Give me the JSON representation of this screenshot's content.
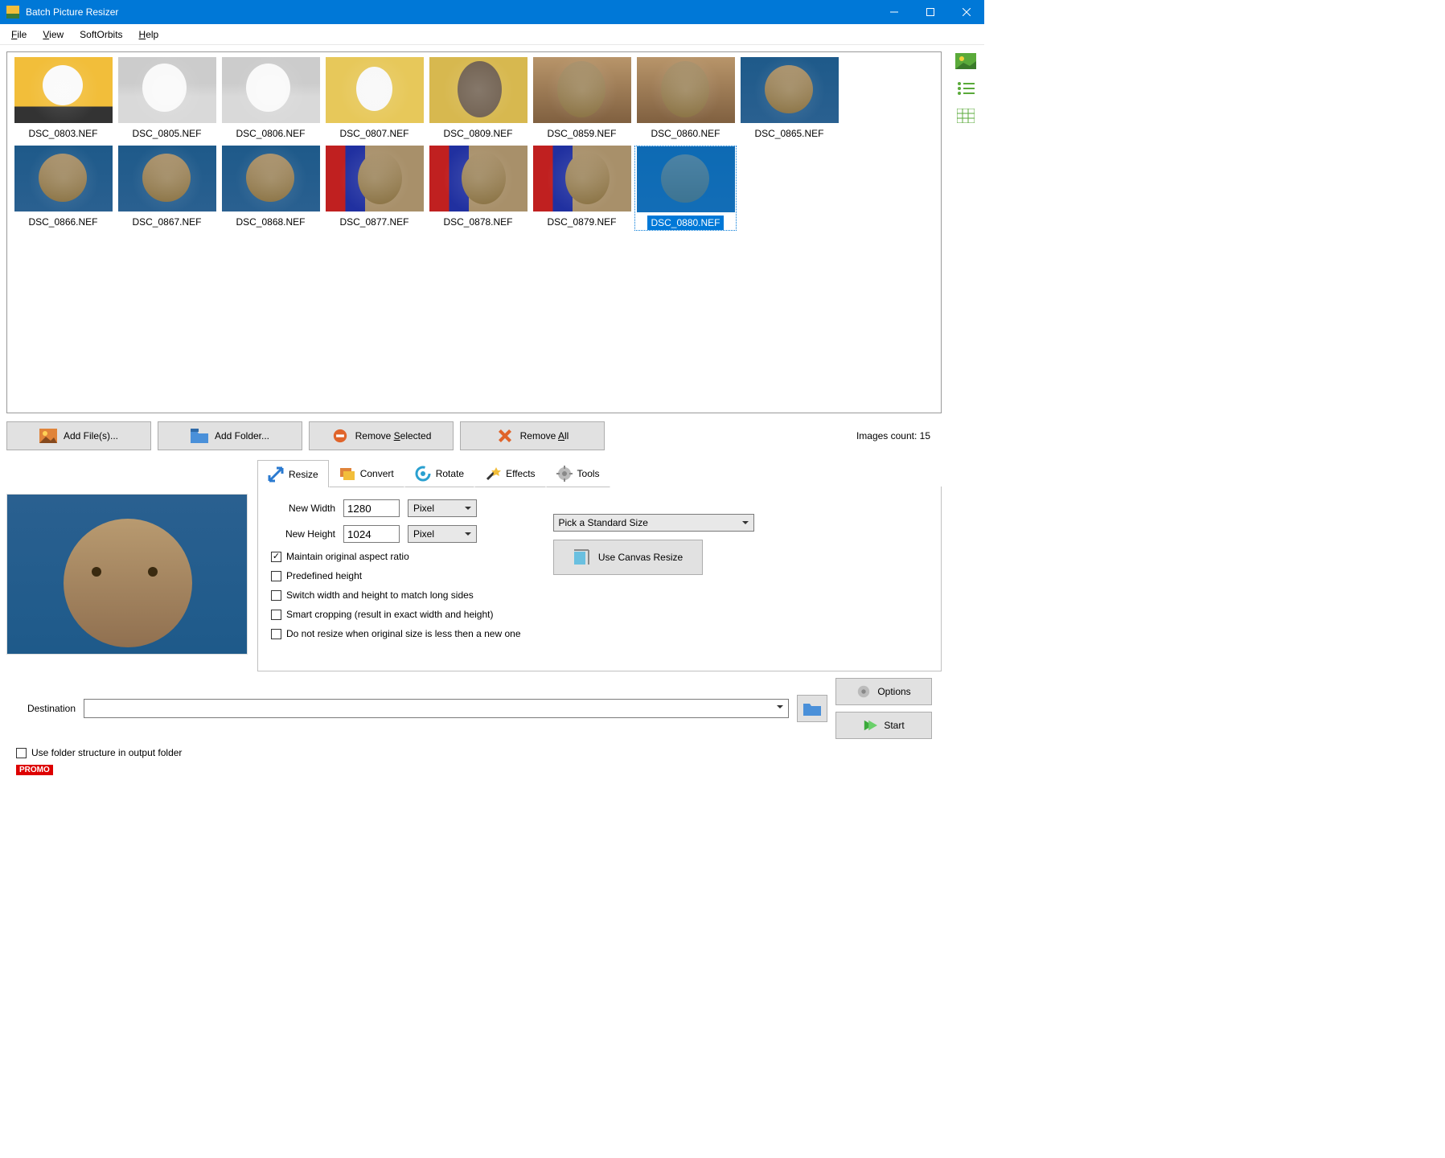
{
  "window": {
    "title": "Batch Picture Resizer",
    "menus": [
      "File",
      "View",
      "SoftOrbits",
      "Help"
    ]
  },
  "side_view_buttons": [
    "thumbnails",
    "list",
    "details"
  ],
  "thumbnails": [
    {
      "label": "DSC_0803.NEF",
      "cls": "white-cat"
    },
    {
      "label": "DSC_0805.NEF",
      "cls": "white-cat2"
    },
    {
      "label": "DSC_0806.NEF",
      "cls": "white-cat2"
    },
    {
      "label": "DSC_0807.NEF",
      "cls": "white-cat3"
    },
    {
      "label": "DSC_0809.NEF",
      "cls": "gray-cat"
    },
    {
      "label": "DSC_0859.NEF",
      "cls": "tabby"
    },
    {
      "label": "DSC_0860.NEF",
      "cls": "tabby"
    },
    {
      "label": "DSC_0865.NEF",
      "cls": "tabby-blue"
    },
    {
      "label": "DSC_0866.NEF",
      "cls": "tabby-blue"
    },
    {
      "label": "DSC_0867.NEF",
      "cls": "tabby-blue"
    },
    {
      "label": "DSC_0868.NEF",
      "cls": "tabby-blue"
    },
    {
      "label": "DSC_0877.NEF",
      "cls": "tabby-color"
    },
    {
      "label": "DSC_0878.NEF",
      "cls": "tabby-color"
    },
    {
      "label": "DSC_0879.NEF",
      "cls": "tabby-color"
    },
    {
      "label": "DSC_0880.NEF",
      "cls": "tabby-blue",
      "selected": true
    }
  ],
  "file_actions": {
    "add_files": "Add File(s)...",
    "add_folder": "Add Folder...",
    "remove_selected": "Remove Selected",
    "remove_all": "Remove All",
    "count_text": "Images count: 15"
  },
  "tabs": {
    "resize": "Resize",
    "convert": "Convert",
    "rotate": "Rotate",
    "effects": "Effects",
    "tools": "Tools"
  },
  "resize": {
    "new_width_label": "New Width",
    "new_width_value": "1280",
    "new_height_label": "New Height",
    "new_height_value": "1024",
    "unit": "Pixel",
    "standard_size": "Pick a Standard Size",
    "canvas_resize": "Use Canvas Resize",
    "cb_aspect": "Maintain original aspect ratio",
    "cb_predef": "Predefined height",
    "cb_switch": "Switch width and height to match long sides",
    "cb_smart": "Smart cropping (result in exact width and height)",
    "cb_noresize": "Do not resize when original size is less then a new one"
  },
  "bottom": {
    "destination_label": "Destination",
    "use_folder_structure": "Use folder structure in output folder",
    "options": "Options",
    "start": "Start",
    "promo": "PROMO"
  }
}
